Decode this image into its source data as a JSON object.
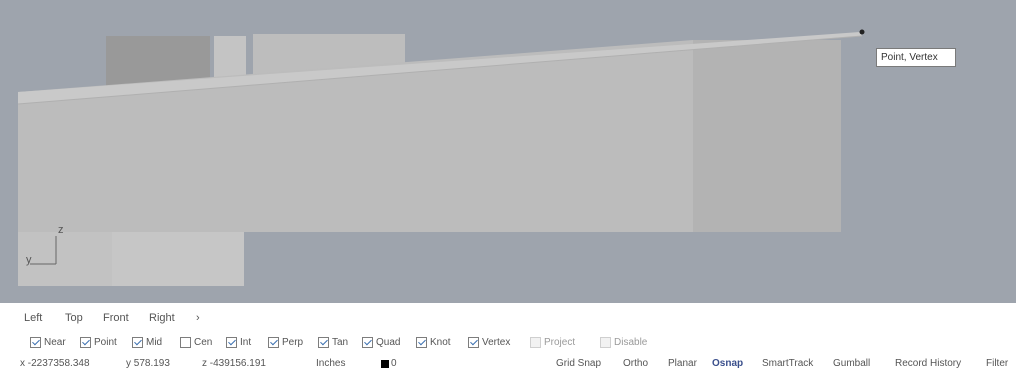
{
  "viewport": {
    "tooltip_text": "Point, Vertex",
    "axis_z": "z",
    "axis_y": "y",
    "colors": {
      "background": "#9ea4ad",
      "box_face": "#bcbcbc",
      "box_dark": "#999999"
    }
  },
  "view_tabs": [
    "Left",
    "Top",
    "Front",
    "Right",
    "›"
  ],
  "osnap": {
    "items": [
      {
        "label": "Near",
        "checked": true
      },
      {
        "label": "Point",
        "checked": true
      },
      {
        "label": "Mid",
        "checked": true
      },
      {
        "label": "Cen",
        "checked": false
      },
      {
        "label": "Int",
        "checked": true
      },
      {
        "label": "Perp",
        "checked": true
      },
      {
        "label": "Tan",
        "checked": true
      },
      {
        "label": "Quad",
        "checked": true
      },
      {
        "label": "Knot",
        "checked": true
      },
      {
        "label": "Vertex",
        "checked": true
      },
      {
        "label": "Project",
        "checked": false,
        "disabled": true
      },
      {
        "label": "Disable",
        "checked": false,
        "disabled": true
      }
    ]
  },
  "status": {
    "x": "x -2237358.348",
    "y": "y 578.193",
    "z": "z -439156.191",
    "units": "Inches",
    "layer": "0",
    "toggles": [
      {
        "label": "Grid Snap",
        "active": false
      },
      {
        "label": "Ortho",
        "active": false
      },
      {
        "label": "Planar",
        "active": false
      },
      {
        "label": "Osnap",
        "active": true
      },
      {
        "label": "SmartTrack",
        "active": false
      },
      {
        "label": "Gumball",
        "active": false
      },
      {
        "label": "Record History",
        "active": false
      },
      {
        "label": "Filter",
        "active": false
      }
    ]
  }
}
